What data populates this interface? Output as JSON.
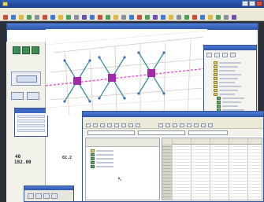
{
  "app": {
    "title": "",
    "menu": [
      "",
      "",
      "",
      "",
      "",
      "",
      "",
      "",
      "",
      ""
    ]
  },
  "document": {
    "title": ""
  },
  "map": {
    "nodes": [
      {
        "label": ""
      },
      {
        "label": ""
      },
      {
        "label": ""
      }
    ]
  },
  "left_panel": {
    "coord_label": "40",
    "coord_value": "182.00",
    "right_coord": "02.2"
  },
  "properties_panel": {
    "title": ""
  },
  "layers_panel": {
    "title": "",
    "items": [
      "",
      "",
      "",
      "",
      "",
      "",
      "",
      "",
      "",
      "",
      "",
      "",
      "",
      "",
      ""
    ]
  },
  "data_window": {
    "title": "",
    "fields": [
      "",
      "",
      ""
    ],
    "tree_header": "",
    "tree_items": [
      "",
      "",
      "",
      "",
      ""
    ],
    "grid_headers": [
      "",
      "",
      "",
      "",
      ""
    ],
    "grid_rows": 18
  },
  "colors": {
    "titlebar": "#2d56a8",
    "node": "#a22aa8",
    "link": "#2b8a9a",
    "selection": "#e23ad0"
  }
}
